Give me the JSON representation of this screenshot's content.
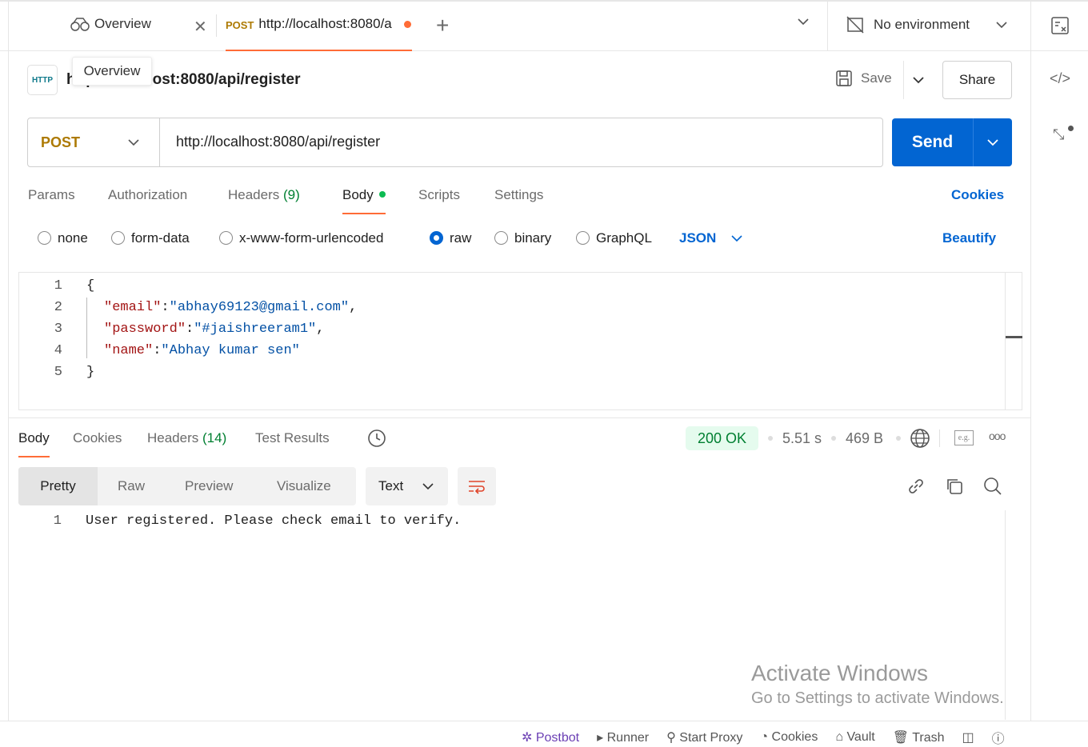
{
  "tabs": [
    {
      "label": "Overview",
      "icon": "binoculars-icon"
    },
    {
      "method": "POST",
      "label": "http://localhost:8080/a"
    }
  ],
  "environment": "No environment",
  "tooltip": "Overview",
  "request_title": "http://localhost:8080/api/register",
  "save_label": "Save",
  "share_label": "Share",
  "method": "POST",
  "url": "http://localhost:8080/api/register",
  "send_label": "Send",
  "req_tabs": [
    {
      "label": "Params"
    },
    {
      "label": "Authorization"
    },
    {
      "label": "Headers",
      "count": "(9)"
    },
    {
      "label": "Body"
    },
    {
      "label": "Scripts"
    },
    {
      "label": "Settings"
    }
  ],
  "cookies_link": "Cookies",
  "body_types": [
    "none",
    "form-data",
    "x-www-form-urlencoded",
    "raw",
    "binary",
    "GraphQL"
  ],
  "body_format": "JSON",
  "beautify": "Beautify",
  "code_lines": [
    {
      "n": "1",
      "parts": [
        {
          "t": "{",
          "c": "p"
        }
      ]
    },
    {
      "n": "2",
      "parts": [
        {
          "t": "\"email\"",
          "c": "k"
        },
        {
          "t": ":",
          "c": "p"
        },
        {
          "t": "\"abhay69123@gmail.com\"",
          "c": "v"
        },
        {
          "t": ",",
          "c": "p"
        }
      ]
    },
    {
      "n": "3",
      "parts": [
        {
          "t": "\"password\"",
          "c": "k"
        },
        {
          "t": ":",
          "c": "p"
        },
        {
          "t": "\"#jaishreeram1\"",
          "c": "v"
        },
        {
          "t": ",",
          "c": "p"
        }
      ]
    },
    {
      "n": "4",
      "parts": [
        {
          "t": "\"name\"",
          "c": "k"
        },
        {
          "t": ":",
          "c": "p"
        },
        {
          "t": "\"Abhay kumar sen\"",
          "c": "v"
        }
      ]
    },
    {
      "n": "5",
      "parts": [
        {
          "t": "}",
          "c": "p"
        }
      ]
    }
  ],
  "res_tabs": [
    {
      "label": "Body"
    },
    {
      "label": "Cookies"
    },
    {
      "label": "Headers",
      "count": "(14)"
    },
    {
      "label": "Test Results"
    }
  ],
  "status": "200 OK",
  "time": "5.51 s",
  "size": "469 B",
  "view_modes": [
    "Pretty",
    "Raw",
    "Preview",
    "Visualize"
  ],
  "res_format": "Text",
  "response_lines": [
    {
      "n": "1",
      "text": "User registered. Please check email to verify."
    }
  ],
  "watermark": {
    "title": "Activate Windows",
    "sub": "Go to Settings to activate Windows."
  },
  "footer": [
    "Postbot",
    "Runner",
    "Start Proxy",
    "Cookies",
    "Vault",
    "Trash"
  ],
  "colors": {
    "accent": "#ff6c37",
    "send": "#0265d2",
    "post": "#ad7a03",
    "ok_bg": "#e5fbee",
    "ok": "#007f31"
  }
}
